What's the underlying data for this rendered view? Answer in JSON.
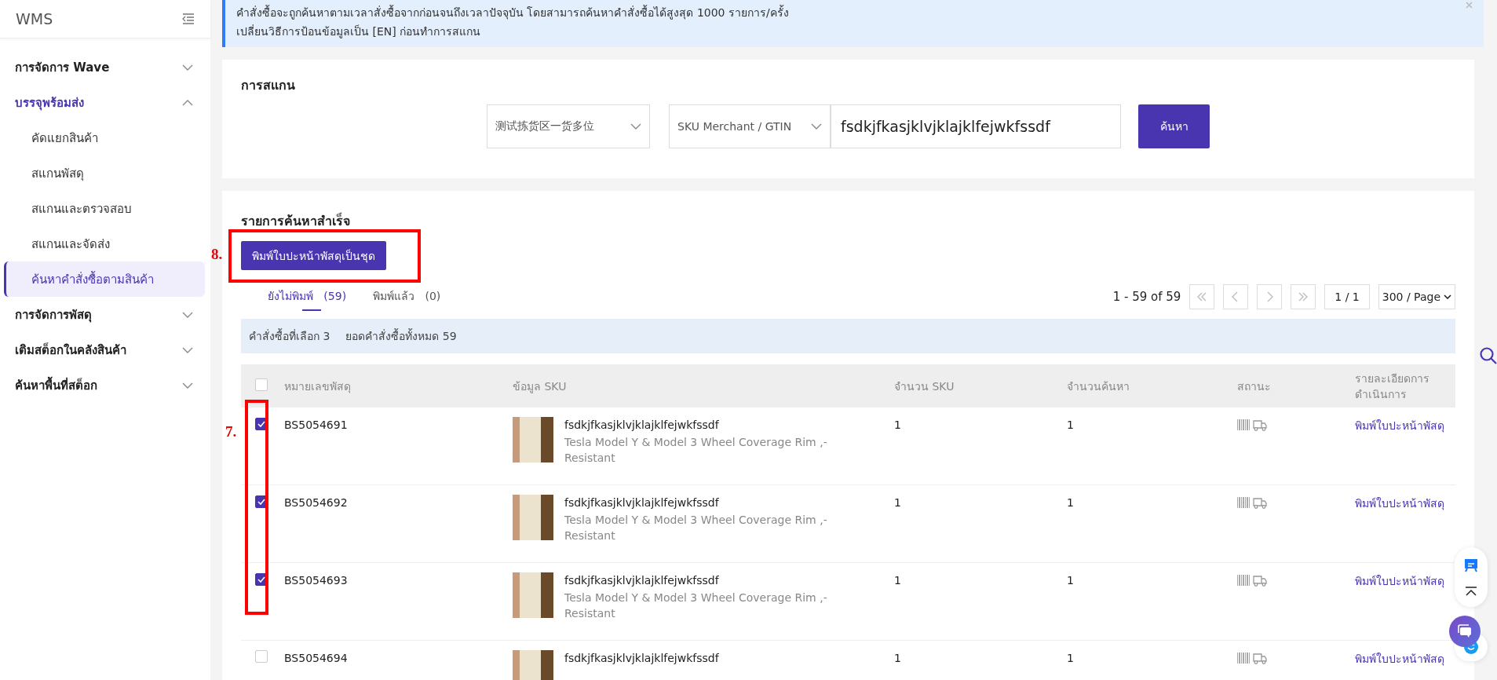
{
  "sidebar": {
    "title": "WMS",
    "items": [
      {
        "label": "การจัดการ Wave",
        "expanded": false
      },
      {
        "label": "บรรจุพร้อมส่ง",
        "expanded": true,
        "children": [
          {
            "label": "คัดแยกสินค้า",
            "selected": false
          },
          {
            "label": "สแกนพัสดุ",
            "selected": false
          },
          {
            "label": "สแกนและตรวจสอบ",
            "selected": false
          },
          {
            "label": "สแกนและจัดส่ง",
            "selected": false
          },
          {
            "label": "ค้นหาคำสั่งซื้อตามสินค้า",
            "selected": true
          }
        ]
      },
      {
        "label": "การจัดการพัสดุ",
        "expanded": false
      },
      {
        "label": "เติมสต็อกในคลังสินค้า",
        "expanded": false
      },
      {
        "label": "ค้นหาพื้นที่สต็อก",
        "expanded": false
      }
    ]
  },
  "notice": {
    "lines": [
      "คำสั่งซื้อจะถูกค้นหาตามเวลาสั่งซื้อจากก่อนจนถึงเวลาปัจจุบัน โดยสามารถค้นหาคำสั่งซื้อได้สูงสุด 1000 รายการ/ครั้ง",
      "เปลี่ยนวิธีการป้อนข้อมูลเป็น [EN] ก่อนทำการสแกน"
    ]
  },
  "scan": {
    "title": "การสแกน",
    "warehouse_select": "测试拣货区一货多位",
    "type_select": "SKU Merchant / GTIN",
    "input": "fsdkjfkasjklvjklajklfejwkfssdf",
    "button": "ค้นหา"
  },
  "results": {
    "title": "รายการค้นหาสำเร็จ",
    "batch_button": "พิมพ์ใบปะหน้าพัสดุเป็นชุด",
    "tabs": [
      {
        "label": "ยังไม่พิมพ์",
        "count": "(59)",
        "selected": true
      },
      {
        "label": "พิมพ์แล้ว",
        "count": "(0)",
        "selected": false
      }
    ],
    "pagination": {
      "range": "1 - 59 of 59",
      "page": "1 / 1",
      "page_size": "300 / Page"
    },
    "summary": [
      "คำสั่งซื้อที่เลือก 3",
      "ยอดคำสั่งซื้อทั้งหมด 59"
    ],
    "table": {
      "header_checked": false,
      "columns": [
        "หมายเลขพัสดุ",
        "ข้อมูล SKU",
        "จำนวน SKU",
        "จำนวนค้นหา",
        "สถานะ",
        "รายละเอียดการดำเนินการ"
      ],
      "rows": [
        {
          "checked": true,
          "parcel_no": "BS5054691",
          "sku_code": "fsdkjfkasjklvjklajklfejwkfssdf",
          "sku_name": "Tesla Model Y & Model 3 Wheel Coverage Rim ,-Resistant",
          "sku_qty": "1",
          "search_qty": "1",
          "action": "พิมพ์ใบปะหน้าพัสดุ"
        },
        {
          "checked": true,
          "parcel_no": "BS5054692",
          "sku_code": "fsdkjfkasjklvjklajklfejwkfssdf",
          "sku_name": "Tesla Model Y & Model 3 Wheel Coverage Rim ,-Resistant",
          "sku_qty": "1",
          "search_qty": "1",
          "action": "พิมพ์ใบปะหน้าพัสดุ"
        },
        {
          "checked": true,
          "parcel_no": "BS5054693",
          "sku_code": "fsdkjfkasjklvjklajklfejwkfssdf",
          "sku_name": "Tesla Model Y & Model 3 Wheel Coverage Rim ,-Resistant",
          "sku_qty": "1",
          "search_qty": "1",
          "action": "พิมพ์ใบปะหน้าพัสดุ"
        },
        {
          "checked": false,
          "parcel_no": "BS5054694",
          "sku_code": "fsdkjfkasjklvjklajklfejwkfssdf",
          "sku_qty": "1",
          "search_qty": "1",
          "action": "พิมพ์ใบปะหน้าพัสดุ"
        }
      ]
    }
  },
  "annotations": [
    {
      "label": "8."
    },
    {
      "label": "7."
    }
  ]
}
